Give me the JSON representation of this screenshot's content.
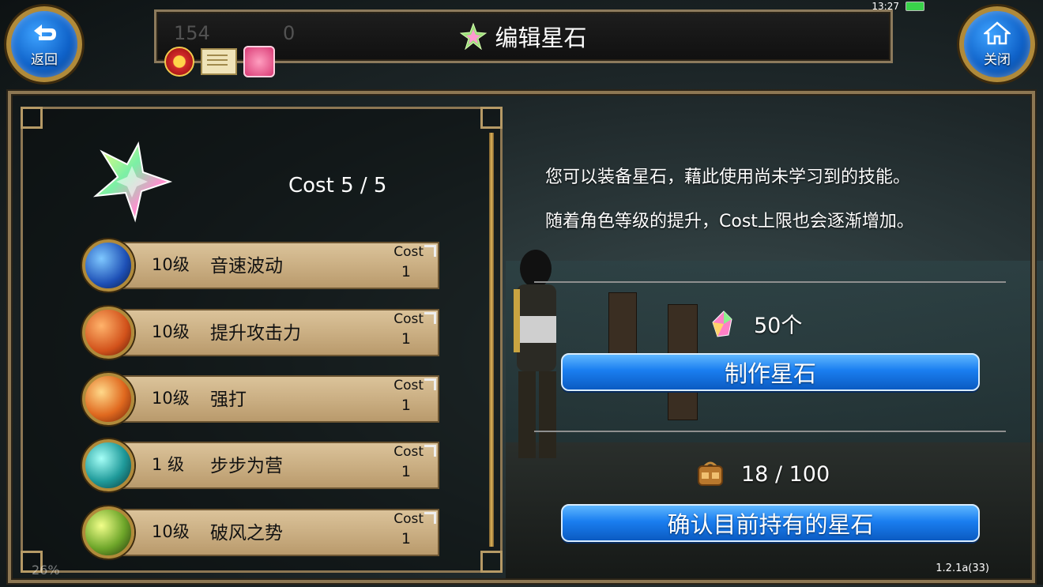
{
  "status_bar": {
    "time": "13:27"
  },
  "nav": {
    "back_label": "返回",
    "close_label": "关闭"
  },
  "title_bar": {
    "title": "编辑星石",
    "ghost_stat_1": "154",
    "ghost_stat_2": "0"
  },
  "left_panel": {
    "cost_total": "Cost 5 / 5",
    "skills": [
      {
        "level": "10级",
        "name": "音速波动",
        "cost_label": "Cost",
        "cost_value": "1",
        "icon": "sonic-wave-icon"
      },
      {
        "level": "10级",
        "name": "提升攻击力",
        "cost_label": "Cost",
        "cost_value": "1",
        "icon": "attack-up-icon"
      },
      {
        "level": "10级",
        "name": "强打",
        "cost_label": "Cost",
        "cost_value": "1",
        "icon": "power-strike-icon"
      },
      {
        "level": "1 级",
        "name": "步步为营",
        "cost_label": "Cost",
        "cost_value": "1",
        "icon": "steady-advance-icon"
      },
      {
        "level": "10级",
        "name": "破风之势",
        "cost_label": "Cost",
        "cost_value": "1",
        "icon": "wind-break-icon"
      }
    ],
    "fps": "26%"
  },
  "right_panel": {
    "desc_line_1": "您可以装备星石，藉此使用尚未学习到的技能。",
    "desc_line_2": "随着角色等级的提升，Cost上限也会逐渐增加。",
    "crystal_count": "50个",
    "craft_button": "制作星石",
    "bag_count": "18 / 100",
    "check_button": "确认目前持有的星石"
  },
  "version": "1.2.1a(33)"
}
